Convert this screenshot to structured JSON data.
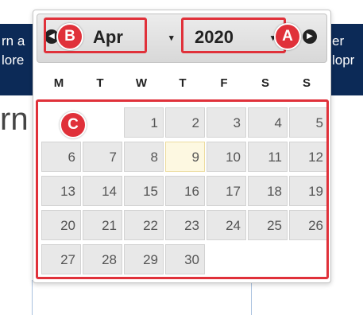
{
  "background": {
    "banner_left_line1": "rn a",
    "banner_left_line2": "lore",
    "banner_right_line1": "er",
    "banner_right_line2": "lopr",
    "heading_fragment": "rn"
  },
  "calendar": {
    "prev_icon": "◀",
    "next_icon": "▶",
    "month": "Apr",
    "year": "2020",
    "dropdown_arrow": "▾",
    "weekdays": [
      "M",
      "T",
      "W",
      "T",
      "F",
      "S",
      "S"
    ],
    "today": "9",
    "weeks": [
      [
        "",
        "",
        "1",
        "2",
        "3",
        "4",
        "5"
      ],
      [
        "6",
        "7",
        "8",
        "9",
        "10",
        "11",
        "12"
      ],
      [
        "13",
        "14",
        "15",
        "16",
        "17",
        "18",
        "19"
      ],
      [
        "20",
        "21",
        "22",
        "23",
        "24",
        "25",
        "26"
      ],
      [
        "27",
        "28",
        "29",
        "30",
        "",
        "",
        ""
      ]
    ]
  },
  "annotations": {
    "year_label": "A",
    "month_label": "B",
    "grid_label": "C",
    "color": "#e0313a"
  }
}
